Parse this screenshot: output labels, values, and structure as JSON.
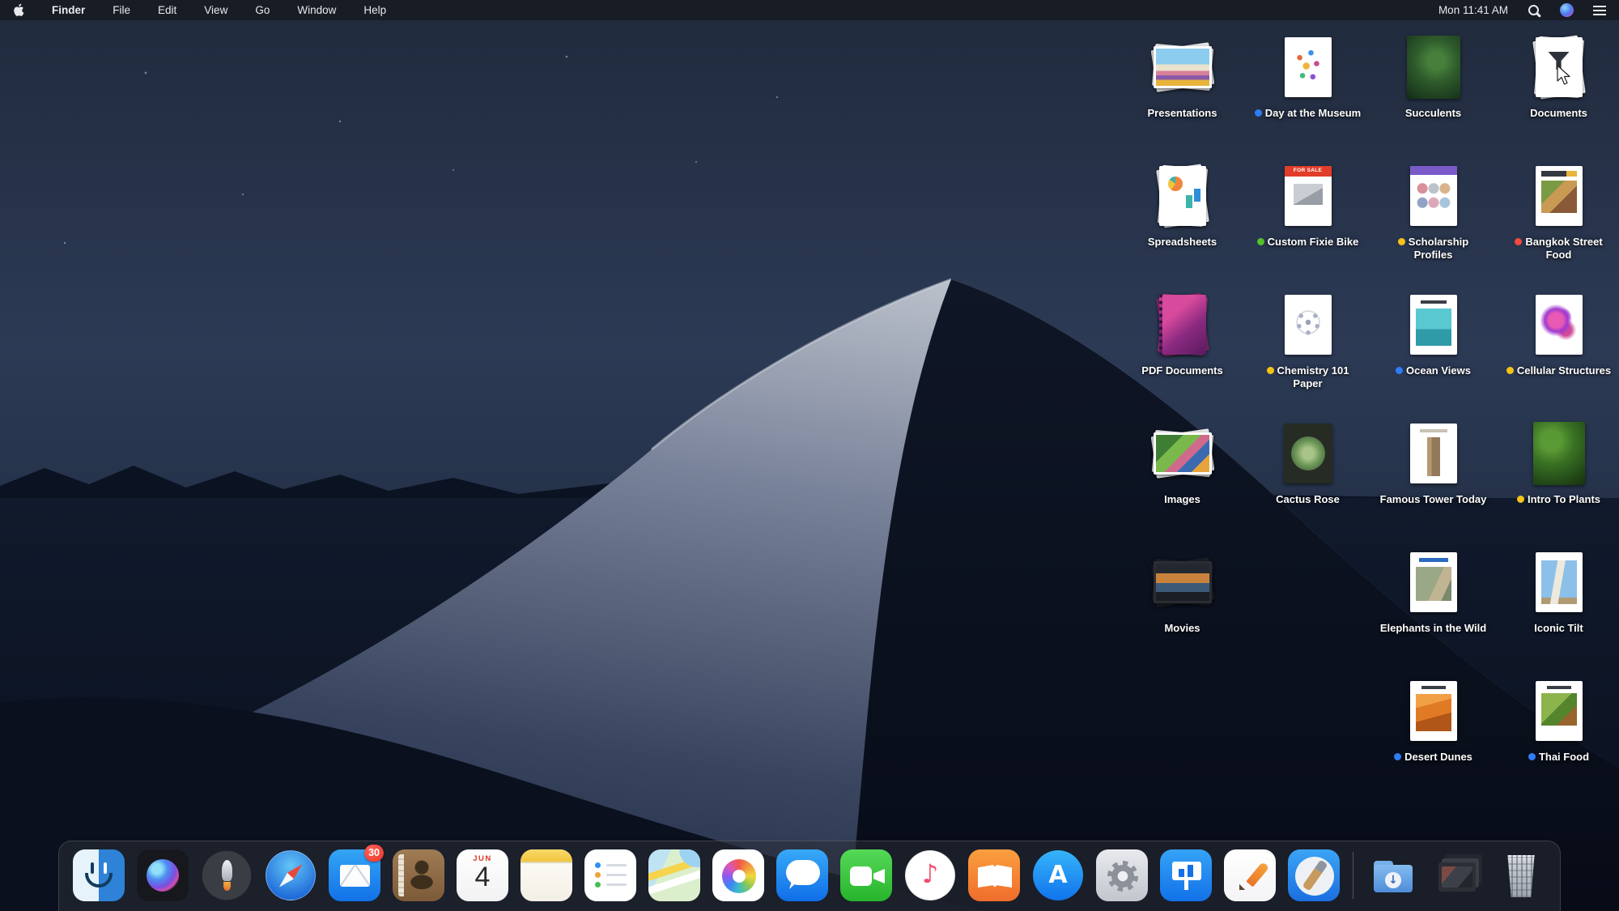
{
  "menu_bar": {
    "app_menu": "Finder",
    "menus": [
      "File",
      "Edit",
      "View",
      "Go",
      "Window",
      "Help"
    ],
    "clock": "Mon 11:41 AM"
  },
  "desktop": {
    "dot_colors": {
      "blue": "#2f7cf6",
      "green": "#53c22b",
      "yellow": "#f5c318",
      "red": "#f04a3e"
    },
    "stacks": [
      {
        "label": "Presentations",
        "kind": "presentations",
        "row": 1,
        "col": 1
      },
      {
        "label": "Day at the Museum",
        "kind": "museum",
        "dot": "blue",
        "row": 1,
        "col": 2
      },
      {
        "label": "Succulents",
        "kind": "succulents",
        "row": 1,
        "col": 3
      },
      {
        "label": "Documents",
        "kind": "documents",
        "row": 1,
        "col": 4
      },
      {
        "label": "Spreadsheets",
        "kind": "spreadsheets",
        "row": 2,
        "col": 1
      },
      {
        "label": "Custom Fixie Bike",
        "kind": "fixie",
        "dot": "green",
        "thumb_text": "FOR SALE",
        "row": 2,
        "col": 2
      },
      {
        "label": "Scholarship Profiles",
        "kind": "scholarship",
        "dot": "yellow",
        "row": 2,
        "col": 3
      },
      {
        "label": "Bangkok Street Food",
        "kind": "bangkok",
        "dot": "red",
        "row": 2,
        "col": 4
      },
      {
        "label": "PDF Documents",
        "kind": "pdf",
        "row": 3,
        "col": 1
      },
      {
        "label": "Chemistry 101 Paper",
        "kind": "chemistry",
        "dot": "yellow",
        "row": 3,
        "col": 2
      },
      {
        "label": "Ocean Views",
        "kind": "ocean",
        "dot": "blue",
        "row": 3,
        "col": 3
      },
      {
        "label": "Cellular Structures",
        "kind": "cellular",
        "dot": "yellow",
        "row": 3,
        "col": 4
      },
      {
        "label": "Images",
        "kind": "images",
        "row": 4,
        "col": 1
      },
      {
        "label": "Cactus Rose",
        "kind": "cactus",
        "row": 4,
        "col": 2
      },
      {
        "label": "Famous Tower Today",
        "kind": "tower",
        "row": 4,
        "col": 3
      },
      {
        "label": "Intro To Plants",
        "kind": "plants",
        "dot": "yellow",
        "row": 4,
        "col": 4
      },
      {
        "label": "Movies",
        "kind": "movies",
        "row": 5,
        "col": 1
      },
      {
        "label": "Elephants in the Wild",
        "kind": "elephants",
        "row": 5,
        "col": 3
      },
      {
        "label": "Iconic Tilt",
        "kind": "tilt",
        "row": 5,
        "col": 4
      },
      {
        "label": "Desert Dunes",
        "kind": "dunes",
        "dot": "blue",
        "row": 6,
        "col": 3
      },
      {
        "label": "Thai Food",
        "kind": "thai",
        "dot": "blue",
        "row": 6,
        "col": 4
      }
    ]
  },
  "dock": {
    "items": [
      {
        "name": "finder"
      },
      {
        "name": "siri"
      },
      {
        "name": "launchpad"
      },
      {
        "name": "safari"
      },
      {
        "name": "mail",
        "badge": "30"
      },
      {
        "name": "contacts"
      },
      {
        "name": "calendar",
        "month": "JUN",
        "day": "4"
      },
      {
        "name": "notes"
      },
      {
        "name": "reminders"
      },
      {
        "name": "maps"
      },
      {
        "name": "photos"
      },
      {
        "name": "messages"
      },
      {
        "name": "facetime"
      },
      {
        "name": "itunes",
        "glyph": "♪"
      },
      {
        "name": "books"
      },
      {
        "name": "appstore",
        "glyph": "A"
      },
      {
        "name": "system-preferences"
      },
      {
        "name": "keynote"
      },
      {
        "name": "pages"
      },
      {
        "name": "xcode"
      },
      {
        "name": "separator"
      },
      {
        "name": "downloads",
        "glyph": "↓"
      },
      {
        "name": "documents-stack"
      },
      {
        "name": "trash"
      }
    ]
  }
}
